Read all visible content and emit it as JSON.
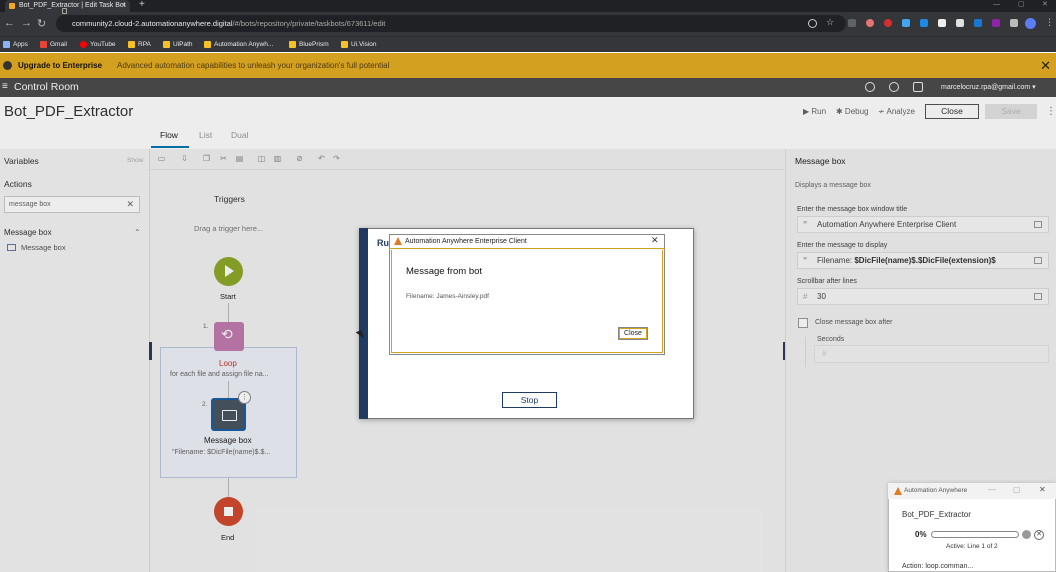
{
  "browser": {
    "tab_title": "Bot_PDF_Extractor | Edit Task Bot",
    "tab_close": "×",
    "new_tab": "+",
    "url_host": "community2.cloud-2.automationanywhere.digital",
    "url_path": "/#/bots/repository/private/taskbots/673611/edit",
    "bookmarks": [
      "Apps",
      "Gmail",
      "YouTube",
      "RPA",
      "UiPath",
      "Automation Anywh...",
      "BluePrism",
      "Ui.Vision"
    ]
  },
  "banner": {
    "title": "Upgrade to Enterprise",
    "description": "Advanced automation capabilities to unleash your organization's full potential",
    "close": "✕"
  },
  "topnav": {
    "menu": "≡",
    "title": "Control Room",
    "email": "marcelocruz.rpa@gmail.com ▾"
  },
  "header": {
    "bot_name": "Bot_PDF_Extractor",
    "run": "▶ Run",
    "debug": "✱ Debug",
    "analyze": "≁ Analyze",
    "close": "Close",
    "save": "Save",
    "kebab": "⋮"
  },
  "views": {
    "flow": "Flow",
    "list": "List",
    "dual": "Dual"
  },
  "left_panel": {
    "variables": "Variables",
    "show": "Show",
    "actions": "Actions",
    "search_value": "message box",
    "search_clear": "✕",
    "group": "Message box",
    "group_chevron": "⌃",
    "item": "Message box"
  },
  "canvas": {
    "triggers": "Triggers",
    "drag_trigger": "Drag a trigger here...",
    "start": "Start",
    "step1_num": "1.",
    "loop_label": "Loop",
    "loop_desc": "for each file and assign file na...",
    "step2_num": "2.",
    "msg_label": "Message box",
    "msg_desc": "\"Filename: $DicFile(name)$.$...",
    "info": "⋮",
    "end": "End"
  },
  "right_panel": {
    "title": "Message box",
    "description": "Displays a message box",
    "field1_label": "Enter the message box window title",
    "field1_value": "Automation Anywhere Enterprise Client",
    "field2_label": "Enter the message to display",
    "field2_prefix": "Filename: ",
    "field2_var": "$DicFile(name)$.$DicFile(extension)$",
    "field3_label": "Scrollbar after lines",
    "field3_value": "30",
    "quote_icon": "❞",
    "hash_icon": "#",
    "checkbox_label": "Close message box after",
    "seconds_label": "Seconds",
    "seconds_placeholder": "#"
  },
  "runner": {
    "title_partial": "Ru",
    "stop": "Stop"
  },
  "message_dialog": {
    "title": "Automation Anywhere Enterprise Client",
    "close_x": "✕",
    "heading": "Message from bot",
    "text": "Filename: James-Ainsley.pdf",
    "close": "Close"
  },
  "mini_window": {
    "title": "Automation Anywhere",
    "minimize": "—",
    "maximize": "▢",
    "close": "✕",
    "bot_name": "Bot_PDF_Extractor",
    "percent": "0%",
    "progress": 0,
    "active": "Active: Line 1 of 2",
    "action": "Action: loop.comman..."
  },
  "colors": {
    "banner": "#d4a020",
    "start_node": "#8da828",
    "loop_node": "#c27bb0",
    "end_node": "#d14b2f",
    "accent": "#0078b4"
  }
}
